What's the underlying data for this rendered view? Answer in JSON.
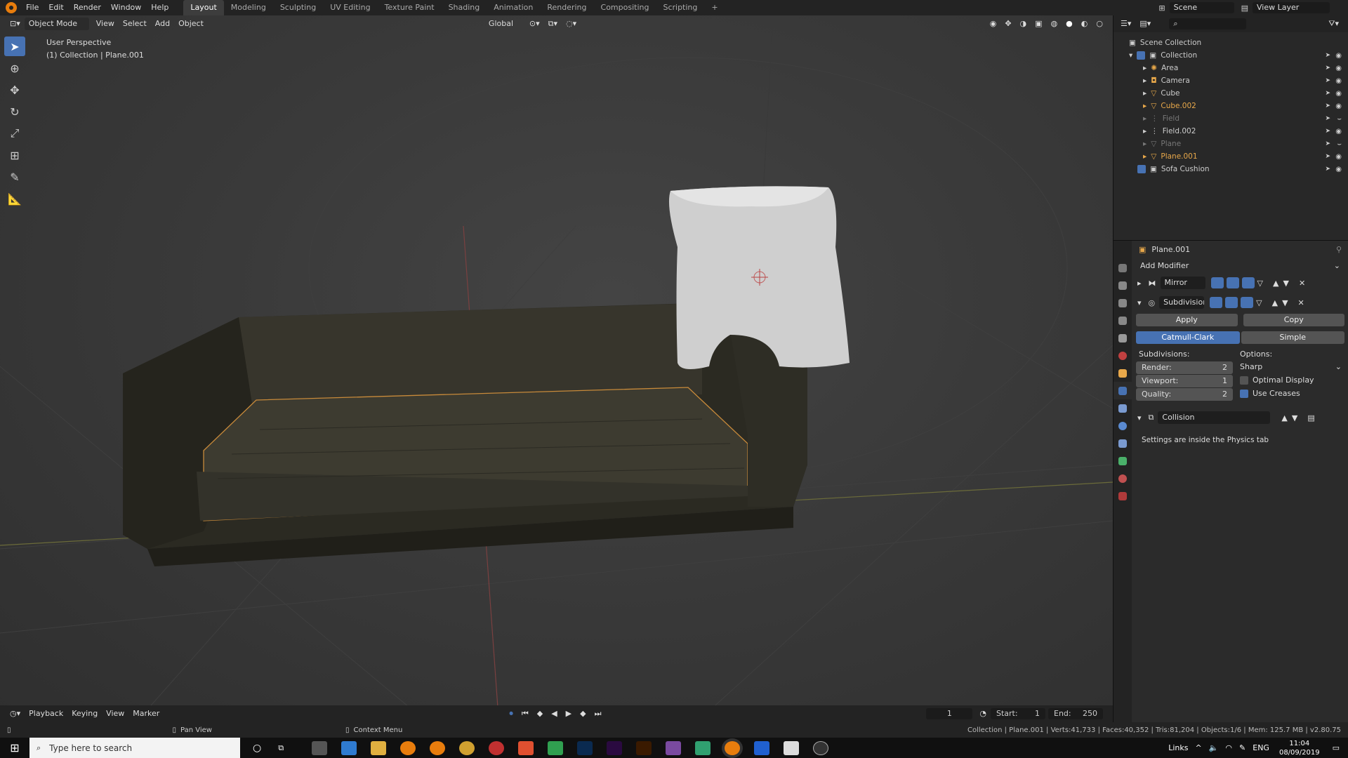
{
  "menu": {
    "items": [
      "File",
      "Edit",
      "Render",
      "Window",
      "Help"
    ],
    "workspaces": [
      "Layout",
      "Modeling",
      "Sculpting",
      "UV Editing",
      "Texture Paint",
      "Shading",
      "Animation",
      "Rendering",
      "Compositing",
      "Scripting"
    ],
    "add_tab": "+",
    "scene_label": "Scene",
    "view_layer_label": "View Layer"
  },
  "viewport": {
    "mode": "Object Mode",
    "menus": [
      "View",
      "Select",
      "Add",
      "Object"
    ],
    "transform_orientation": "Global",
    "info_line1": "User Perspective",
    "info_line2": "(1) Collection | Plane.001"
  },
  "outliner": {
    "root": "Scene Collection",
    "collection": "Collection",
    "items": [
      {
        "name": "Area",
        "state": "normal"
      },
      {
        "name": "Camera",
        "state": "normal"
      },
      {
        "name": "Cube",
        "state": "normal"
      },
      {
        "name": "Cube.002",
        "state": "selected"
      },
      {
        "name": "Field",
        "state": "hidden"
      },
      {
        "name": "Field.002",
        "state": "normal"
      },
      {
        "name": "Plane",
        "state": "hidden"
      },
      {
        "name": "Plane.001",
        "state": "active"
      }
    ],
    "sofa_collection": "Sofa Cushion"
  },
  "properties": {
    "object_name": "Plane.001",
    "add_modifier": "Add Modifier",
    "modifiers": [
      {
        "name": "Mirror",
        "expanded": false
      },
      {
        "name": "Subdivision",
        "expanded": true
      },
      {
        "name": "Collision",
        "expanded": true
      }
    ],
    "subdivision": {
      "apply": "Apply",
      "copy": "Copy",
      "catmull": "Catmull-Clark",
      "simple": "Simple",
      "subdivisions_label": "Subdivisions:",
      "options_label": "Options:",
      "render_label": "Render:",
      "render_value": "2",
      "viewport_label": "Viewport:",
      "viewport_value": "1",
      "quality_label": "Quality:",
      "quality_value": "2",
      "uv_smooth": "Sharp",
      "optimal_display": "Optimal Display",
      "optimal_display_checked": false,
      "use_creases": "Use Creases",
      "use_creases_checked": true
    },
    "collision_note": "Settings are inside the Physics tab"
  },
  "timeline": {
    "menus": [
      "Playback",
      "Keying",
      "View",
      "Marker"
    ],
    "current_frame": "1",
    "start_label": "Start:",
    "start_value": "1",
    "end_label": "End:",
    "end_value": "250"
  },
  "statusbar": {
    "left_hint": "Pan View",
    "mid_hint": "Context Menu",
    "stats": "Collection | Plane.001 | Verts:41,733 | Faces:40,352 | Tris:81,204 | Objects:1/6 | Mem: 125.7 MB | v2.80.75"
  },
  "taskbar": {
    "search_placeholder": "Type here to search",
    "links_label": "Links",
    "lang": "ENG",
    "time": "11:04",
    "date": "08/09/2019"
  },
  "colors": {
    "accent_blue": "#4772b3",
    "selection_orange": "#e8a84a",
    "panel_bg": "#2b2b2b",
    "header_bg": "#232323"
  }
}
